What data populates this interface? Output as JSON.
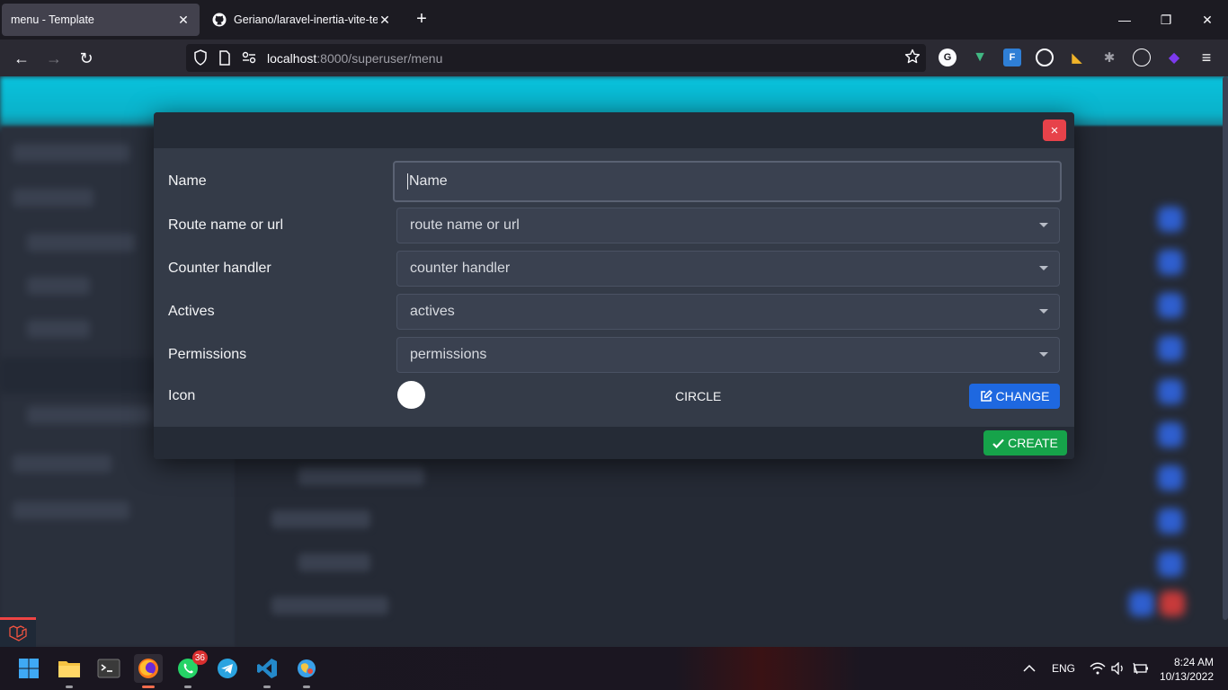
{
  "browser": {
    "tabs": [
      {
        "title": "menu - Template",
        "active": true
      },
      {
        "title": "Geriano/laravel-inertia-vite-tem",
        "active": false
      }
    ],
    "url_host": "localhost",
    "url_path": ":8000/superuser/menu"
  },
  "modal": {
    "close_icon": "×",
    "rows": {
      "name": {
        "label": "Name",
        "value": "Name"
      },
      "route": {
        "label": "Route name or url",
        "placeholder": "route name or url"
      },
      "counter": {
        "label": "Counter handler",
        "placeholder": "counter handler"
      },
      "actives": {
        "label": "Actives",
        "placeholder": "actives"
      },
      "permissions": {
        "label": "Permissions",
        "placeholder": "permissions"
      },
      "icon": {
        "label": "Icon",
        "value": "CIRCLE"
      }
    },
    "change_button": "CHANGE",
    "create_button": "CREATE"
  },
  "taskbar": {
    "whatsapp_badge": "36",
    "language": "ENG",
    "time": "8:24 AM",
    "date": "10/13/2022"
  },
  "colors": {
    "header_accent": "#09c2dc",
    "close_red": "#e7424a",
    "change_blue": "#1e68e0",
    "create_green": "#16a34a"
  }
}
